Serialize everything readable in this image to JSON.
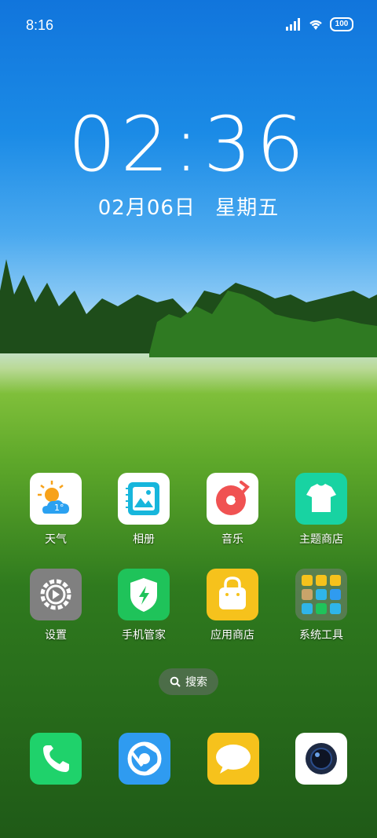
{
  "status_bar": {
    "time": "8:16",
    "battery": "100",
    "signal_icon": "signal-icon",
    "wifi_icon": "wifi-icon"
  },
  "lock_clock": {
    "time": "02:36",
    "date": "02月06日",
    "weekday": "星期五"
  },
  "home_grid": [
    {
      "label": "天气",
      "icon": "weather-icon",
      "weather_temp": "1°"
    },
    {
      "label": "相册",
      "icon": "gallery-icon"
    },
    {
      "label": "音乐",
      "icon": "music-icon"
    },
    {
      "label": "主题商店",
      "icon": "theme-store-icon"
    },
    {
      "label": "设置",
      "icon": "settings-icon"
    },
    {
      "label": "手机管家",
      "icon": "phone-manager-icon"
    },
    {
      "label": "应用商店",
      "icon": "app-store-icon"
    },
    {
      "label": "系统工具",
      "icon": "system-tools-folder-icon"
    }
  ],
  "search": {
    "label": "搜索",
    "icon": "search-icon"
  },
  "dock": [
    {
      "icon": "phone-icon"
    },
    {
      "icon": "browser-icon"
    },
    {
      "icon": "messages-icon"
    },
    {
      "icon": "camera-icon"
    }
  ],
  "colors": {
    "sky_top": "#1175dc",
    "grass": "#5ea82a",
    "phone_green": "#1fd26b",
    "browser_blue": "#2f9bf0",
    "message_yellow": "#f6c21c"
  }
}
